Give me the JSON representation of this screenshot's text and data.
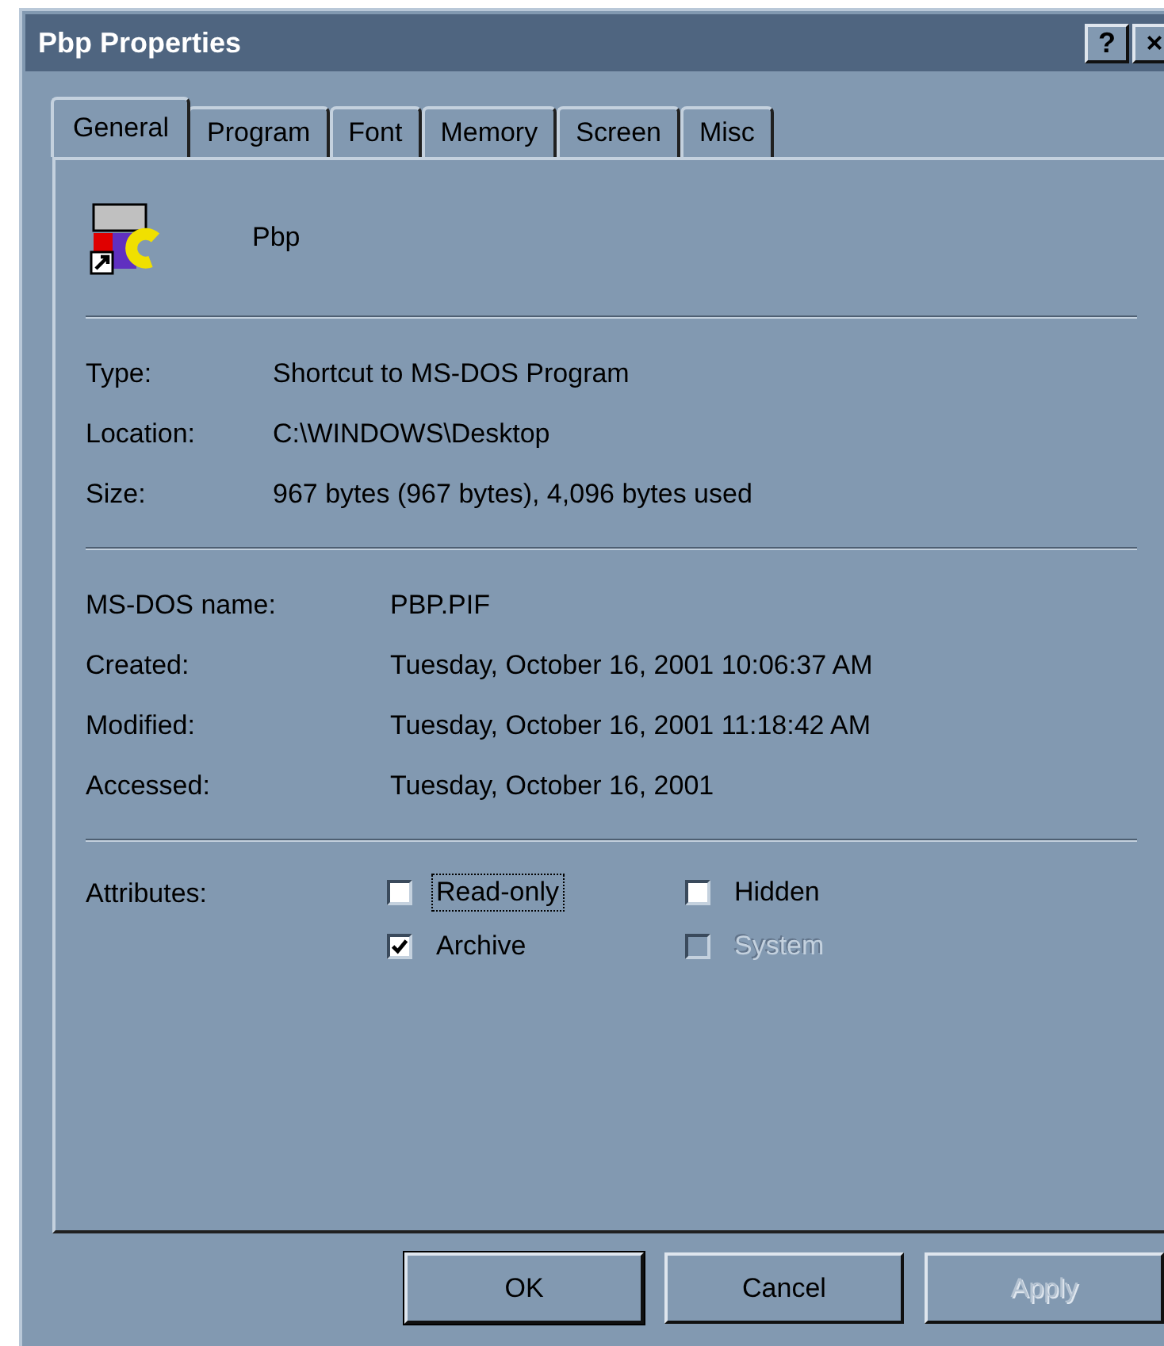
{
  "window": {
    "title": "Pbp Properties",
    "title_buttons": [
      "?",
      "×"
    ]
  },
  "tabs": [
    {
      "label": "General",
      "selected": true
    },
    {
      "label": "Program",
      "selected": false
    },
    {
      "label": "Font",
      "selected": false
    },
    {
      "label": "Memory",
      "selected": false
    },
    {
      "label": "Screen",
      "selected": false
    },
    {
      "label": "Misc",
      "selected": false
    }
  ],
  "file": {
    "name": "Pbp"
  },
  "info": [
    {
      "label": "Type:",
      "value": "Shortcut to MS-DOS Program"
    },
    {
      "label": "Location:",
      "value": "C:\\WINDOWS\\Desktop"
    },
    {
      "label": "Size:",
      "value": "967 bytes (967 bytes), 4,096 bytes used"
    }
  ],
  "details": [
    {
      "label": "MS-DOS name:",
      "value": "PBP.PIF"
    },
    {
      "label": "Created:",
      "value": "Tuesday, October 16, 2001 10:06:37 AM"
    },
    {
      "label": "Modified:",
      "value": "Tuesday, October 16, 2001 11:18:42 AM"
    },
    {
      "label": "Accessed:",
      "value": "Tuesday, October 16, 2001"
    }
  ],
  "attributes": {
    "label": "Attributes:",
    "items": [
      {
        "label": "Read-only",
        "checked": false,
        "disabled": false,
        "focused": true
      },
      {
        "label": "Hidden",
        "checked": false,
        "disabled": false,
        "focused": false
      },
      {
        "label": "Archive",
        "checked": true,
        "disabled": false,
        "focused": false
      },
      {
        "label": "System",
        "checked": false,
        "disabled": true,
        "focused": false
      }
    ]
  },
  "buttons": [
    {
      "label": "OK",
      "default": true,
      "disabled": false
    },
    {
      "label": "Cancel",
      "default": false,
      "disabled": false
    },
    {
      "label": "Apply",
      "default": false,
      "disabled": true
    }
  ]
}
